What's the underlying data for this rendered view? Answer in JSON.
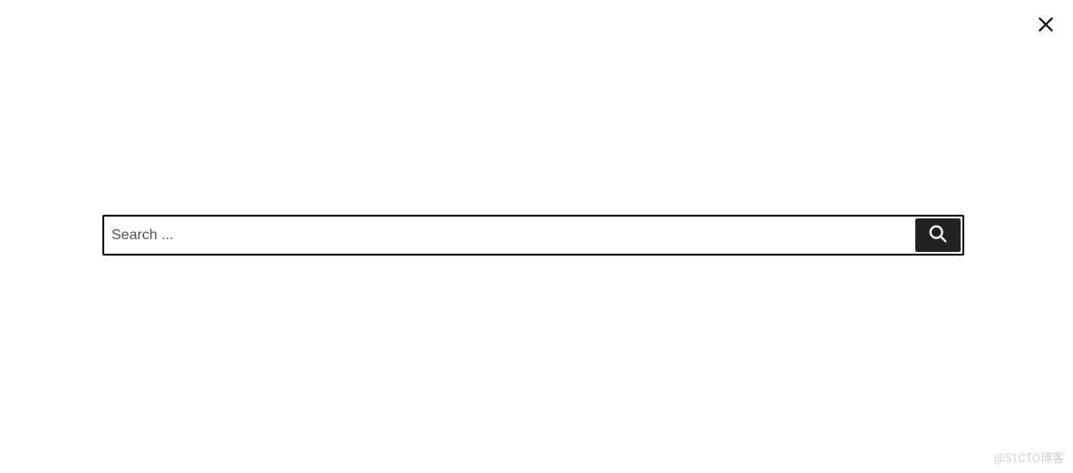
{
  "search": {
    "placeholder": "Search ...",
    "value": ""
  },
  "watermark": "@51CTO博客"
}
